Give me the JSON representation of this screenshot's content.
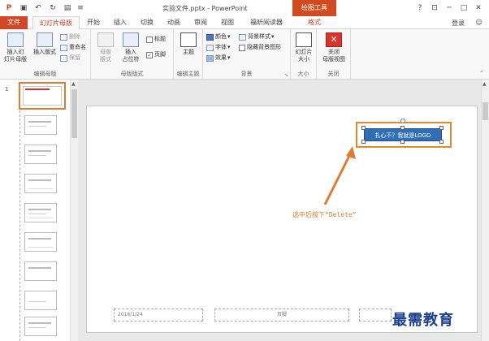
{
  "titlebar": {
    "title": "实验文件.pptx - PowerPoint",
    "context_tab": "绘图工具",
    "help": "?",
    "minimize": "─",
    "restore": "□",
    "close": "✕"
  },
  "tabs": {
    "file": "文件",
    "items": [
      "幻灯片母版",
      "开始",
      "插入",
      "切换",
      "动画",
      "审阅",
      "视图",
      "福昕阅读器",
      "格式"
    ],
    "login": "登录"
  },
  "ribbon": {
    "groups": {
      "edit_master": {
        "label": "编辑母版",
        "insert_master": "插入幻\n灯片母版",
        "insert_layout": "插入版式",
        "delete": "删除",
        "rename": "重命名",
        "preserve": "保留"
      },
      "master_layout": {
        "label": "母版版式",
        "master_layout_btn": "母版\n版式",
        "insert_placeholder": "插入\n占位符",
        "title_chk": "标题",
        "footer_chk": "页脚"
      },
      "edit_theme": {
        "label": "编辑主题",
        "theme": "主题"
      },
      "background": {
        "label": "背景",
        "colors": "颜色",
        "fonts": "字体",
        "effects": "效果",
        "bg_styles": "背景样式",
        "hide_bg": "隐藏背景图形"
      },
      "size": {
        "label": "大小",
        "slide_size": "幻灯片\n大小"
      },
      "close": {
        "label": "关闭",
        "close_master": "关闭\n母版视图"
      }
    }
  },
  "slide": {
    "logo_text": "扎心不？我就是LOGO",
    "date_placeholder": "2016/1/24",
    "footer_placeholder": "页脚",
    "annotation": "选中后按下“Delete”"
  },
  "watermark": "最需教育",
  "colors": {
    "accent": "#d24726",
    "highlight": "#e07b2f",
    "logo_bg": "#2f6fb6"
  }
}
